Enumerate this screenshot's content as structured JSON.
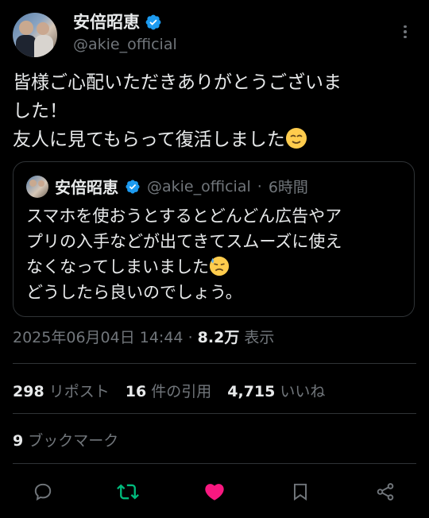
{
  "author": {
    "display_name": "安倍昭恵",
    "handle": "@akie_official"
  },
  "tweet": {
    "line1": "皆様ご心配いただきありがとうございま",
    "line2": "した！",
    "line3": "友人に見てもらって復活しました",
    "emoji": "relieved-face"
  },
  "quote": {
    "display_name": "安倍昭恵",
    "handle": "@akie_official",
    "separator": "·",
    "time": "6時間",
    "line1": "スマホを使おうとするとどんどん広告やア",
    "line2": "プリの入手などが出てきてスムーズに使え",
    "line3": "なくなってしまいました",
    "line4": "どうしたら良いのでしょう。",
    "emoji": "downcast-sweat-face"
  },
  "meta": {
    "datetime": "2025年06月04日 14:44",
    "separator": "·",
    "views": "8.2万",
    "views_label": "表示"
  },
  "stats": {
    "reposts": "298",
    "reposts_label": "リポスト",
    "quotes": "16",
    "quotes_label": "件の引用",
    "likes": "4,715",
    "likes_label": "いいね",
    "bookmarks": "9",
    "bookmarks_label": "ブックマーク"
  },
  "colors": {
    "background": "#000000",
    "verified": "#1d9bf0",
    "repost_active": "#00ba7c",
    "like_active": "#f91880",
    "muted": "#71767b"
  },
  "icons": [
    "verified-badge-icon",
    "more-icon",
    "reply-icon",
    "repost-icon",
    "like-icon",
    "bookmark-icon",
    "share-icon"
  ]
}
